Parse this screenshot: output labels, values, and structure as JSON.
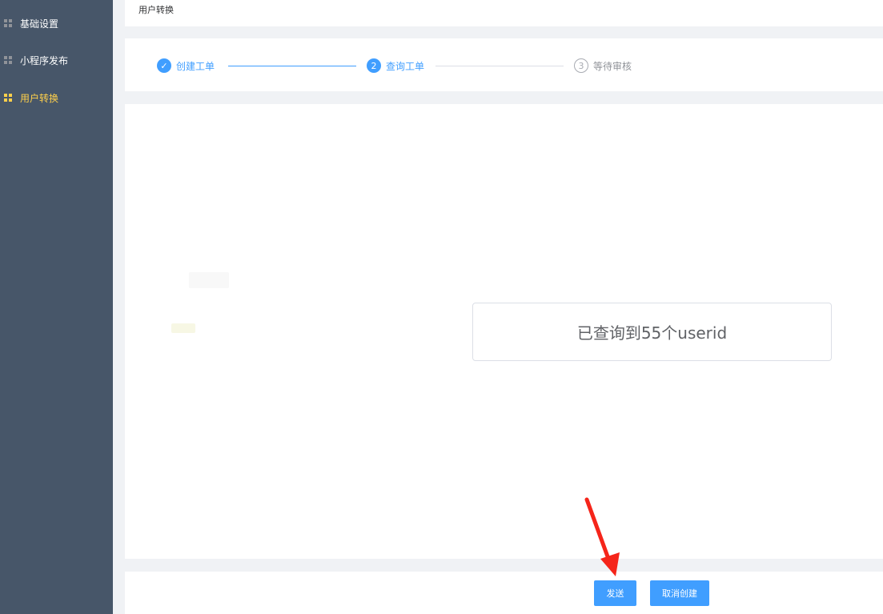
{
  "sidebar": {
    "items": [
      {
        "label": "基础设置",
        "icon": "grid-icon",
        "active": false
      },
      {
        "label": "小程序发布",
        "icon": "grid-icon",
        "active": false
      },
      {
        "label": "用户转换",
        "icon": "grid-icon",
        "active": true
      }
    ]
  },
  "header": {
    "title": "用户转换"
  },
  "steps": [
    {
      "index": "✓",
      "label": "创建工单",
      "status": "done"
    },
    {
      "index": "2",
      "label": "查询工单",
      "status": "current"
    },
    {
      "index": "3",
      "label": "等待审核",
      "status": "waiting"
    }
  ],
  "result": {
    "text": "已查询到55个userid"
  },
  "footer": {
    "send_label": "发送",
    "cancel_label": "取消创建"
  },
  "colors": {
    "primary": "#409eff",
    "sidebar": "#475669",
    "active": "#ffd04b",
    "arrow": "#f5251a"
  }
}
